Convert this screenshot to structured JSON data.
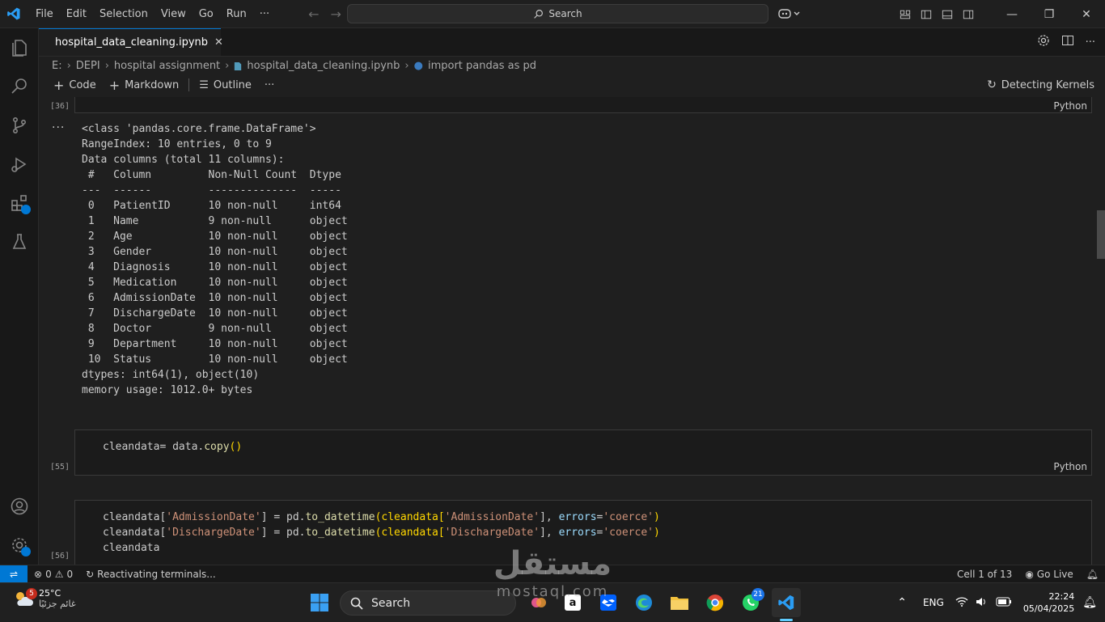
{
  "titlebar": {
    "menu": [
      "File",
      "Edit",
      "Selection",
      "View",
      "Go",
      "Run",
      "···"
    ],
    "search_placeholder": "Search"
  },
  "tab": {
    "name": "hospital_data_cleaning.ipynb",
    "close": "✕"
  },
  "breadcrumb": [
    "E:",
    "DEPI",
    "hospital assignment",
    "hospital_data_cleaning.ipynb",
    "import pandas as pd"
  ],
  "toolbar": {
    "code": "Code",
    "markdown": "Markdown",
    "outline": "Outline",
    "more": "···",
    "kernel_status": "Detecting Kernels"
  },
  "cells": {
    "cell1": {
      "exec": "[36]",
      "lang": "Python"
    },
    "output": {
      "dots": "···",
      "lines": [
        "<class 'pandas.core.frame.DataFrame'>",
        "RangeIndex: 10 entries, 0 to 9",
        "Data columns (total 11 columns):",
        " #   Column         Non-Null Count  Dtype ",
        "---  ------         --------------  ----- ",
        " 0   PatientID      10 non-null     int64 ",
        " 1   Name           9 non-null      object",
        " 2   Age            10 non-null     object",
        " 3   Gender         10 non-null     object",
        " 4   Diagnosis      10 non-null     object",
        " 5   Medication     10 non-null     object",
        " 6   AdmissionDate  10 non-null     object",
        " 7   DischargeDate  10 non-null     object",
        " 8   Doctor         9 non-null      object",
        " 9   Department     10 non-null     object",
        " 10  Status         10 non-null     object",
        "dtypes: int64(1), object(10)",
        "memory usage: 1012.0+ bytes"
      ]
    },
    "cell2": {
      "exec": "[55]",
      "lang": "Python",
      "code_a": "cleandata= data.",
      "code_fn": "copy",
      "code_b": "()"
    },
    "cell3": {
      "exec": "[56]",
      "l1": {
        "a": "cleandata[",
        "s1": "'AdmissionDate'",
        "b": "] = pd.",
        "fn": "to_datetime",
        "c": "(cleandata[",
        "s2": "'AdmissionDate'",
        "d": "], ",
        "kw": "errors",
        "e": "=",
        "s3": "'coerce'",
        "f": ")"
      },
      "l2": {
        "a": "cleandata[",
        "s1": "'DischargeDate'",
        "b": "] = pd.",
        "fn": "to_datetime",
        "c": "(cleandata[",
        "s2": "'DischargeDate'",
        "d": "], ",
        "kw": "errors",
        "e": "=",
        "s3": "'coerce'",
        "f": ")"
      },
      "l3": "cleandata"
    }
  },
  "statusbar": {
    "errors": "0",
    "warnings": "0",
    "activity": "Reactivating terminals...",
    "cell_pos": "Cell 1 of 13",
    "golive": "Go Live"
  },
  "taskbar": {
    "weather_badge": "5",
    "temp": "25°C",
    "condition": "غائم جزئيًا",
    "search": "Search",
    "whatsapp_badge": "21",
    "lang": "ENG",
    "time": "22:24",
    "date": "05/04/2025"
  },
  "watermark": {
    "ar": "مستقل",
    "lat": "mostaql.com"
  },
  "colors": {
    "accent": "#0078d4",
    "string": "#ce9178",
    "function": "#dcdcaa",
    "keyword": "#9cdcfe"
  }
}
